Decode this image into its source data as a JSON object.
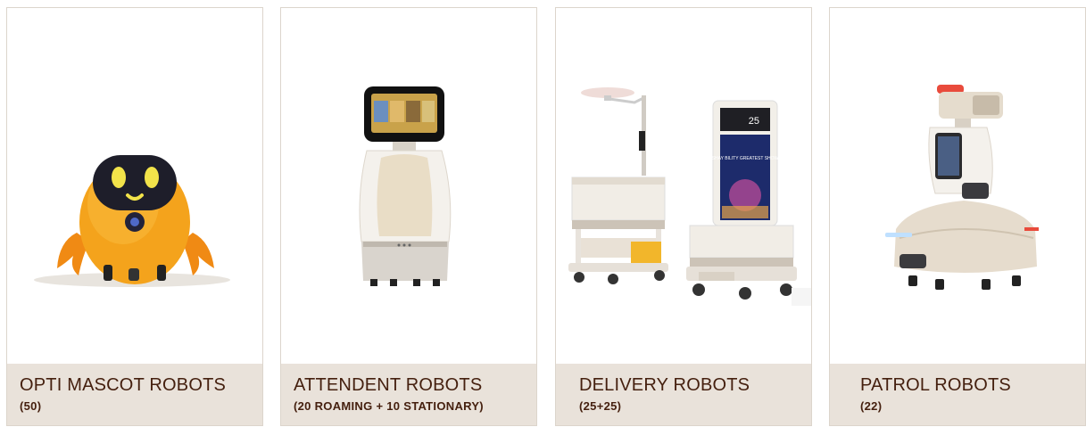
{
  "cards": [
    {
      "title": "OPTI MASCOT ROBOTS",
      "subtitle": "(50)",
      "image_icon": "mascot-robot"
    },
    {
      "title": "ATTENDENT ROBOTS",
      "subtitle": "(20 ROAMING + 10 STATIONARY)",
      "image_icon": "attendant-robot"
    },
    {
      "title": "DELIVERY ROBOTS",
      "subtitle": "(25+25)",
      "image_icon": "delivery-robot"
    },
    {
      "title": "PATROL ROBOTS",
      "subtitle": "(22)",
      "image_icon": "patrol-robot"
    }
  ],
  "screen_texts": {
    "delivery_sign_number": "25",
    "delivery_sign_text": "SHAY BILITY GREATEST SHOW"
  },
  "colors": {
    "caption_bg": "#e9e2da",
    "caption_text": "#45200f",
    "mascot_orange": "#f4a31c",
    "robot_white": "#f4f1ec",
    "robot_beige": "#d9cbb8",
    "patrol_red": "#e94b3c"
  }
}
